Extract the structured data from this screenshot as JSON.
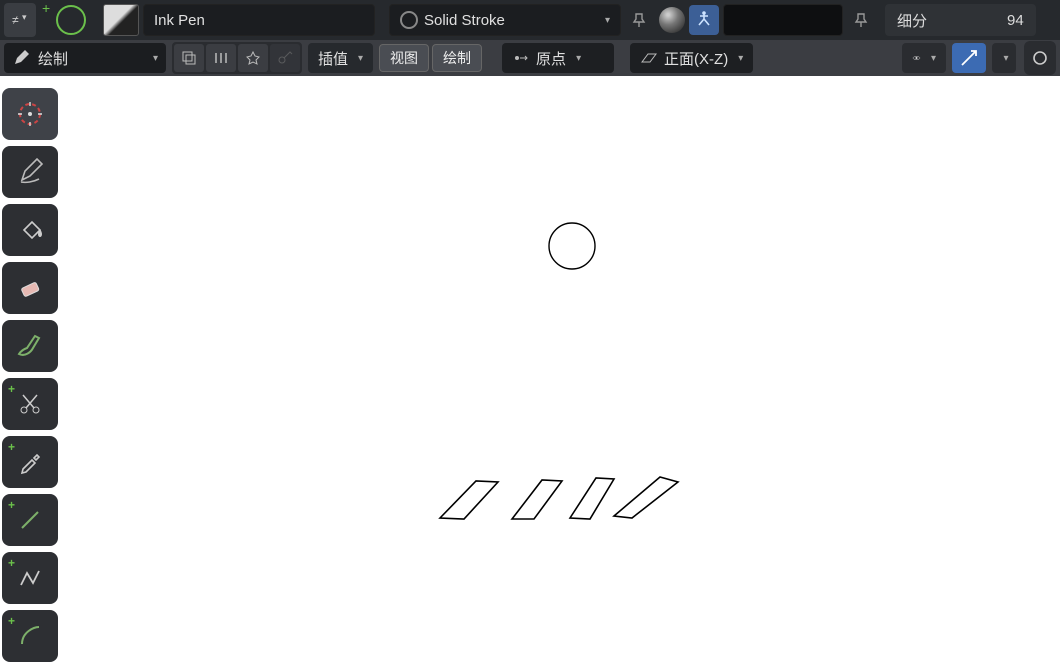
{
  "topbar1": {
    "brush_name": "Ink Pen",
    "stroke_label": "Solid Stroke",
    "right_label": "细分",
    "right_value": "94"
  },
  "topbar2": {
    "mode_label": "绘制",
    "interp_label": "插值",
    "view_label": "视图",
    "draw_label": "绘制",
    "origin_label": "原点",
    "plane_label": "正面(X-Z)"
  },
  "tools": {
    "cursor": "cursor",
    "draw": "draw",
    "fill": "fill",
    "erase": "erase",
    "tint": "tint",
    "cutter": "cutter",
    "eyedropper": "eyedropper",
    "line": "line",
    "polyline": "polyline",
    "arc": "arc"
  }
}
